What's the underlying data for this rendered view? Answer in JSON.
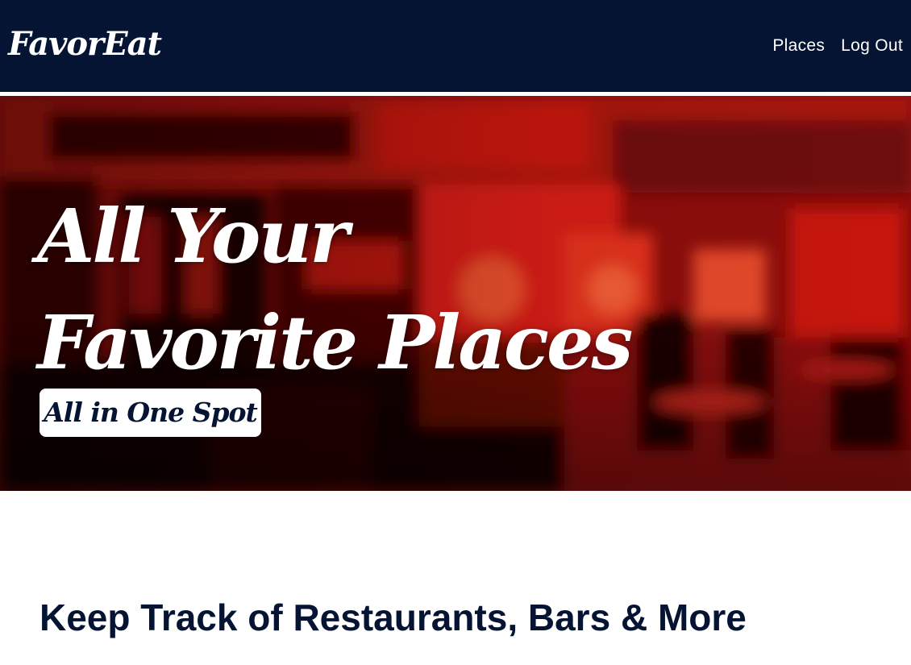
{
  "nav": {
    "logo": "FavorEat",
    "links": [
      "Places",
      "Log Out"
    ]
  },
  "hero": {
    "title_line1": "All Your",
    "title_line2": "Favorite Places",
    "badge": "All in One Spot"
  },
  "main": {
    "heading": "Keep Track of Restaurants, Bars & More"
  },
  "colors": {
    "navy": "#061434",
    "hero_red": "#c4120e",
    "white": "#ffffff"
  }
}
